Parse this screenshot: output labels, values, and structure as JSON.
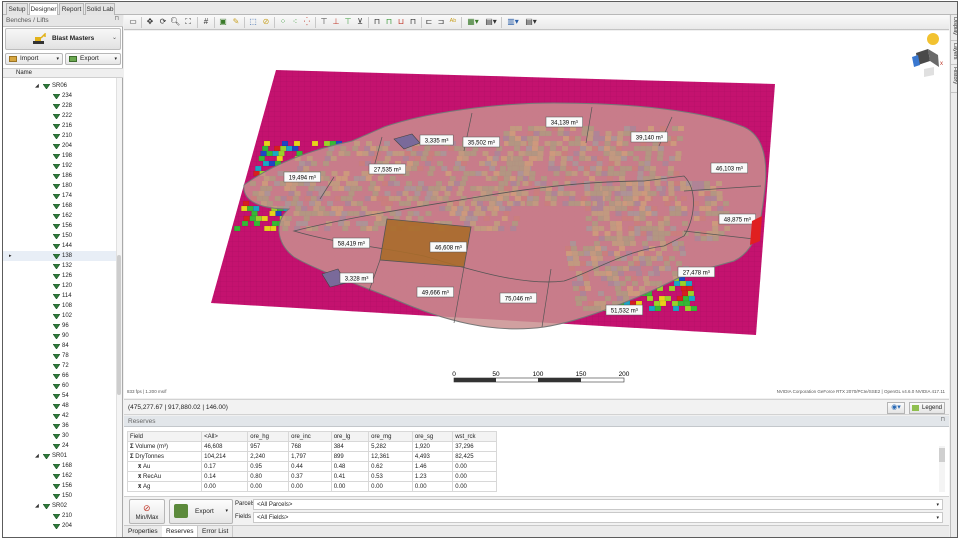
{
  "top_tabs": [
    "Setup",
    "Designer",
    "Report",
    "Solid Lab"
  ],
  "active_tab": "Designer",
  "left_panel": {
    "title": "Benches / Lifts",
    "brand": "Blast Masters",
    "import_label": "Import",
    "export_label": "Export",
    "tree_column": "Name",
    "tree": [
      {
        "label": "SR06",
        "level": 0,
        "expanded": true
      },
      {
        "label": "234",
        "level": 1
      },
      {
        "label": "228",
        "level": 1
      },
      {
        "label": "222",
        "level": 1
      },
      {
        "label": "216",
        "level": 1
      },
      {
        "label": "210",
        "level": 1
      },
      {
        "label": "204",
        "level": 1
      },
      {
        "label": "198",
        "level": 1
      },
      {
        "label": "192",
        "level": 1
      },
      {
        "label": "186",
        "level": 1
      },
      {
        "label": "180",
        "level": 1
      },
      {
        "label": "174",
        "level": 1
      },
      {
        "label": "168",
        "level": 1
      },
      {
        "label": "162",
        "level": 1
      },
      {
        "label": "156",
        "level": 1
      },
      {
        "label": "150",
        "level": 1
      },
      {
        "label": "144",
        "level": 1
      },
      {
        "label": "138",
        "level": 1,
        "selected": true
      },
      {
        "label": "132",
        "level": 1
      },
      {
        "label": "126",
        "level": 1
      },
      {
        "label": "120",
        "level": 1
      },
      {
        "label": "114",
        "level": 1
      },
      {
        "label": "108",
        "level": 1
      },
      {
        "label": "102",
        "level": 1
      },
      {
        "label": "96",
        "level": 1
      },
      {
        "label": "90",
        "level": 1
      },
      {
        "label": "84",
        "level": 1
      },
      {
        "label": "78",
        "level": 1
      },
      {
        "label": "72",
        "level": 1
      },
      {
        "label": "66",
        "level": 1
      },
      {
        "label": "60",
        "level": 1
      },
      {
        "label": "54",
        "level": 1
      },
      {
        "label": "48",
        "level": 1
      },
      {
        "label": "42",
        "level": 1
      },
      {
        "label": "36",
        "level": 1
      },
      {
        "label": "30",
        "level": 1
      },
      {
        "label": "24",
        "level": 1
      },
      {
        "label": "SR01",
        "level": 0,
        "expanded": true
      },
      {
        "label": "168",
        "level": 1
      },
      {
        "label": "162",
        "level": 1
      },
      {
        "label": "156",
        "level": 1
      },
      {
        "label": "150",
        "level": 1
      },
      {
        "label": "SR02",
        "level": 0,
        "expanded": true
      },
      {
        "label": "210",
        "level": 1
      },
      {
        "label": "204",
        "level": 1
      }
    ]
  },
  "right_tabs": [
    "Display",
    "Layers",
    "History"
  ],
  "viewport": {
    "parcels": [
      {
        "label": "3,335 m³"
      },
      {
        "label": "35,502 m³"
      },
      {
        "label": "34,139 m³"
      },
      {
        "label": "39,140 m³"
      },
      {
        "label": "19,494 m³"
      },
      {
        "label": "27,535 m³"
      },
      {
        "label": "46,103 m³"
      },
      {
        "label": "48,875 m³"
      },
      {
        "label": "58,419 m³"
      },
      {
        "label": "46,608 m³"
      },
      {
        "label": "27,478 m³"
      },
      {
        "label": "3,328 m³"
      },
      {
        "label": "49,666 m³"
      },
      {
        "label": "75,046 m³"
      },
      {
        "label": "51,532 m³"
      }
    ],
    "scale_labels": [
      "0",
      "50",
      "100",
      "150",
      "200"
    ],
    "fps": "833 fps | 1.200 ms/f",
    "gpu": "NVIDIA Corporation GeForce RTX 2070/PCIe/SSE2 | OpenGL v4.6.0 NVIDIA 417.11"
  },
  "coords": "(475,277.67 | 917,880.02 | 146.00)",
  "legend_label": "Legend",
  "reserves": {
    "title": "Reserves",
    "columns": [
      "Field",
      "<All>",
      "ore_hg",
      "ore_inc",
      "ore_lg",
      "ore_mg",
      "ore_sg",
      "wst_rck"
    ],
    "rows": [
      {
        "icon": "Σ",
        "name": "Volume (m³)",
        "values": [
          "46,608",
          "957",
          "768",
          "384",
          "5,282",
          "1,920",
          "37,296"
        ]
      },
      {
        "icon": "Σ",
        "name": "DryTonnes",
        "values": [
          "104,214",
          "2,240",
          "1,797",
          "899",
          "12,361",
          "4,493",
          "82,425"
        ]
      },
      {
        "icon": "x̄",
        "name": "Au",
        "values": [
          "0.17",
          "0.95",
          "0.44",
          "0.48",
          "0.62",
          "1.46",
          "0.00"
        ]
      },
      {
        "icon": "x̄",
        "name": "RecAu",
        "values": [
          "0.14",
          "0.80",
          "0.37",
          "0.41",
          "0.53",
          "1.23",
          "0.00"
        ]
      },
      {
        "icon": "x̄",
        "name": "Ag",
        "values": [
          "0.00",
          "0.00",
          "0.00",
          "0.00",
          "0.00",
          "0.00",
          "0.00"
        ]
      }
    ],
    "minmax_label": "Min/Max",
    "export_label": "Export",
    "parcels_label": "Parcels",
    "parcels_value": "<All Parcels>",
    "fields_label": "Fields",
    "fields_value": "<All Fields>"
  },
  "bottom_tabs": [
    "Properties",
    "Reserves",
    "Error List"
  ],
  "active_bottom_tab": "Reserves",
  "colors": {
    "waste": "#c4126f",
    "parcel_fill": "#c98f8f",
    "selected_parcel": "#a86b2a",
    "ore_green": "#36b836",
    "ore_lime": "#9ad12b",
    "ore_yellow": "#e8d21a",
    "ore_blue": "#1f45c4",
    "ore_cyan": "#1aa6c4",
    "ore_red": "#d61f1f"
  }
}
